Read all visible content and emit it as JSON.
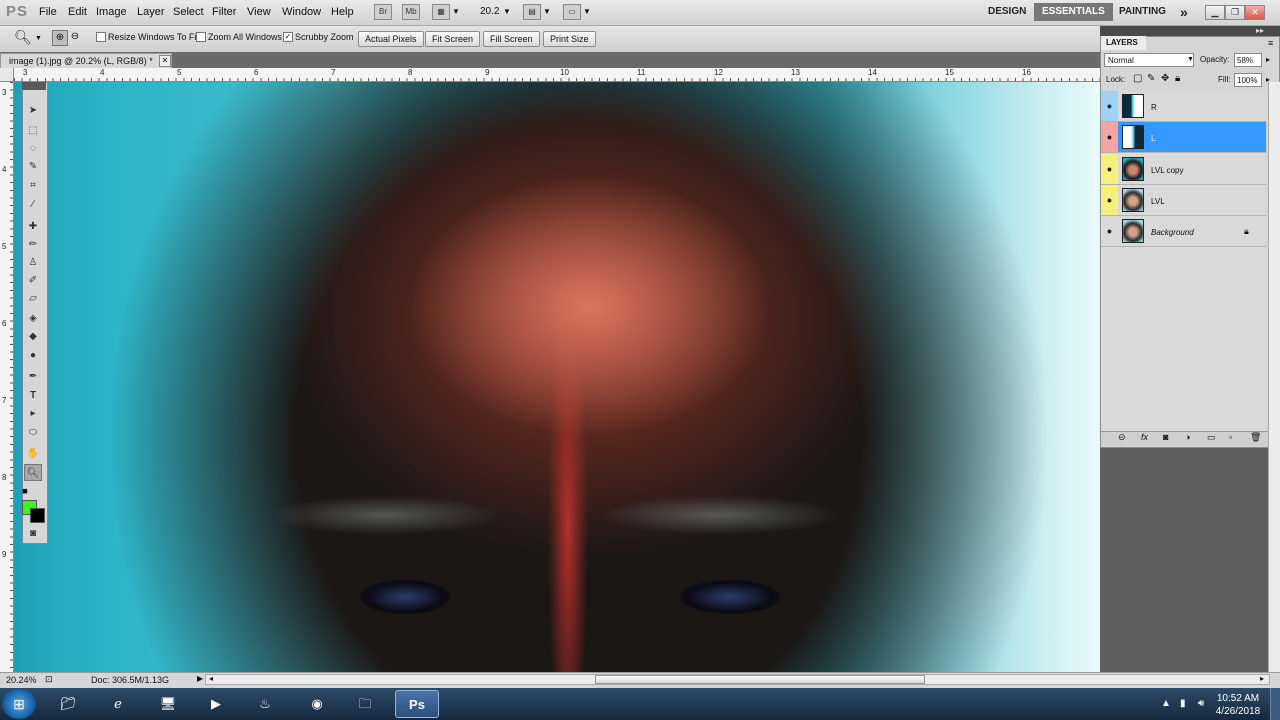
{
  "app": {
    "logo": "PS"
  },
  "menu": [
    "File",
    "Edit",
    "Image",
    "Layer",
    "Select",
    "Filter",
    "View",
    "Window",
    "Help"
  ],
  "appbar": {
    "br_label": "Br",
    "mb_label": "Mb",
    "zoom_value": "20.2"
  },
  "workspaces": [
    "DESIGN",
    "ESSENTIALS",
    "PAINTING"
  ],
  "workspace_more": "»",
  "options": {
    "resize_windows": "Resize Windows To Fit",
    "zoom_all": "Zoom All Windows",
    "scrubby": "Scrubby Zoom",
    "buttons": [
      "Actual Pixels",
      "Fit Screen",
      "Fill Screen",
      "Print Size"
    ]
  },
  "document": {
    "tab_title": "image (1).jpg @ 20.2% (L, RGB/8) *"
  },
  "ruler": {
    "h_ticks": [
      "3",
      "4",
      "5",
      "6",
      "7",
      "8",
      "9",
      "10",
      "11",
      "12",
      "13",
      "14",
      "15",
      "16"
    ],
    "v_ticks": [
      "3",
      "4",
      "5",
      "6",
      "7",
      "8",
      "9"
    ]
  },
  "layers_panel": {
    "title": "LAYERS",
    "blend_mode": "Normal",
    "opacity_label": "Opacity:",
    "opacity_value": "58%",
    "lock_label": "Lock:",
    "fill_label": "Fill:",
    "fill_value": "100%",
    "layers": [
      {
        "name": "R",
        "eye_color": "#9fd0f5",
        "selected": false
      },
      {
        "name": "L",
        "eye_color": "#f5a3a3",
        "selected": true
      },
      {
        "name": "LVL copy",
        "eye_color": "#f5f07a",
        "selected": false
      },
      {
        "name": "LVL",
        "eye_color": "#f5f07a",
        "selected": false
      },
      {
        "name": "Background",
        "eye_color": "#d9d9d9",
        "selected": false,
        "locked": true
      }
    ]
  },
  "status": {
    "zoom": "20.24%",
    "doc": "Doc: 306.5M/1.13G"
  },
  "colors": {
    "foreground": "#3cf51d",
    "background": "#000000",
    "selection": "#3399ff"
  },
  "taskbar": {
    "apps": [
      "explorer-icon",
      "ie-icon",
      "computer-icon",
      "media-icon",
      "app-icon",
      "chrome-icon",
      "folder-icon",
      "photoshop-icon"
    ],
    "ps_label": "Ps",
    "time": "10:52 AM",
    "date": "4/26/2018"
  }
}
